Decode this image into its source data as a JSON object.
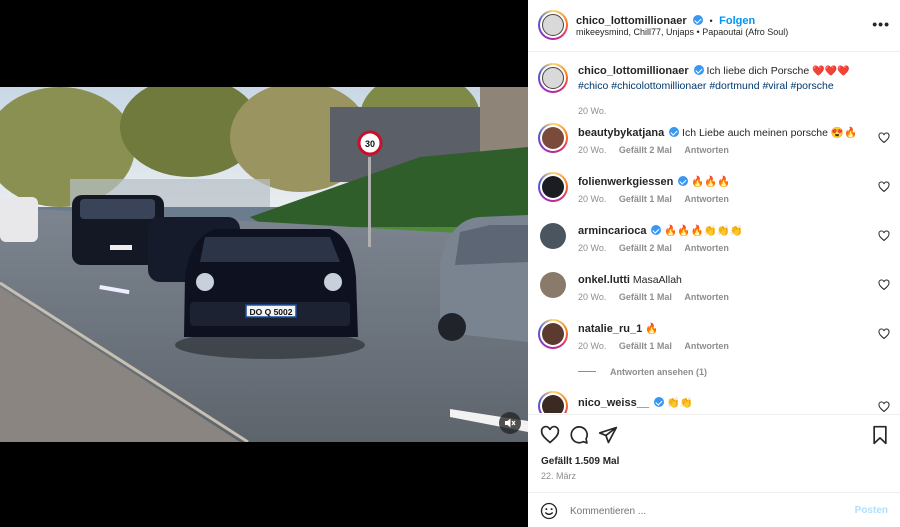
{
  "post": {
    "author": "chico_lottomillionaer",
    "follow_label": "Folgen",
    "separator": "•",
    "audio": "mikeeysmind, Chill77, Unjaps • Papaoutai (Afro Soul)",
    "more_label": "•••",
    "plate": "DO Q 5002",
    "likes_text": "Gefällt 1.509 Mal",
    "date": "22. März"
  },
  "caption": {
    "author": "chico_lottomillionaer",
    "text": "Ich liebe dich Porsche",
    "emoji": "❤️❤️❤️",
    "tags": [
      "#chico",
      "#chicolottomillionaer",
      "#dortmund",
      "#viral",
      "#porsche"
    ],
    "age": "20 Wo."
  },
  "comments": [
    {
      "user": "beautybykatjana",
      "text": "Ich Liebe auch meinen porsche 😍🔥",
      "age": "20 Wo.",
      "likes": "Gefällt 2 Mal",
      "reply": "Antworten"
    },
    {
      "user": "folienwerkgiessen",
      "text": "🔥🔥🔥",
      "age": "20 Wo.",
      "likes": "Gefällt 1 Mal",
      "reply": "Antworten"
    },
    {
      "user": "armincarioca",
      "text": "🔥🔥🔥👏👏👏",
      "age": "20 Wo.",
      "likes": "Gefällt 2 Mal",
      "reply": "Antworten"
    },
    {
      "user": "onkel.lutti",
      "text": "MasaAllah",
      "age": "20 Wo.",
      "likes": "Gefällt 1 Mal",
      "reply": "Antworten"
    },
    {
      "user": "natalie_ru_1",
      "text": "🔥",
      "age": "20 Wo.",
      "likes": "Gefällt 1 Mal",
      "reply": "Antworten"
    },
    {
      "user": "nico_weiss__",
      "text": "👏👏",
      "age": "",
      "likes": "",
      "reply": ""
    }
  ],
  "view_replies": "Antworten ansehen (1)",
  "compose": {
    "placeholder": "Kommentieren ...",
    "post_label": "Posten"
  },
  "icons": {
    "like": "heart-icon",
    "comment": "comment-icon",
    "share": "share-icon",
    "save": "bookmark-icon",
    "emoji": "smiley-icon",
    "mute": "speaker-muted-icon"
  },
  "colors": {
    "link": "#0095f6",
    "hashtag": "#00376b",
    "verified": "#3897f0",
    "muted_text": "#8e8e8e"
  }
}
